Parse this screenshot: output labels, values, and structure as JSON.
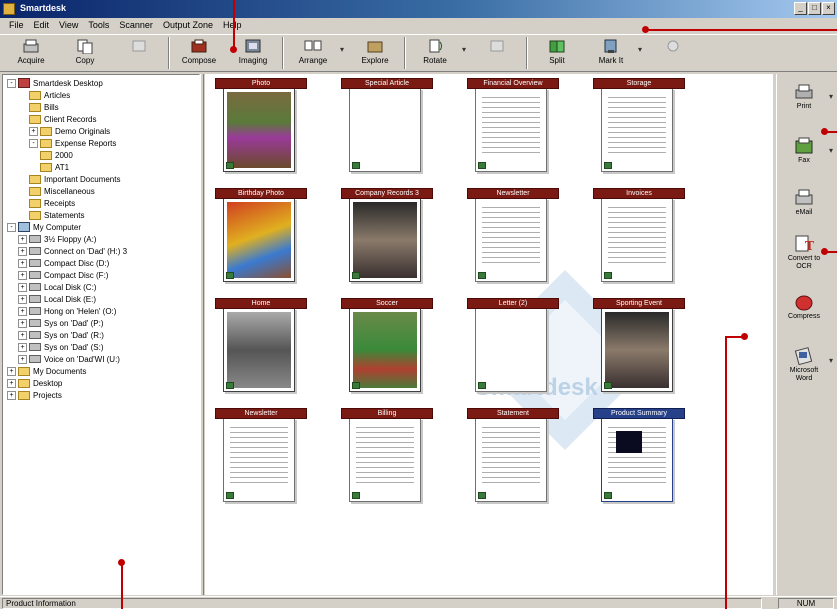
{
  "window": {
    "title": "Smartdesk"
  },
  "menubar": [
    "File",
    "Edit",
    "View",
    "Tools",
    "Scanner",
    "Output Zone",
    "Help"
  ],
  "toolbar": [
    {
      "label": "Acquire",
      "icon": "acquire-icon"
    },
    {
      "label": "Copy",
      "icon": "copy-icon"
    },
    {
      "label": "",
      "icon": "stack-icon",
      "disabled": true
    },
    {
      "label": "Compose",
      "icon": "compose-icon"
    },
    {
      "label": "Imaging",
      "icon": "imaging-icon"
    },
    {
      "label": "Arrange",
      "icon": "arrange-icon"
    },
    {
      "label": "Explore",
      "icon": "explore-icon"
    },
    {
      "label": "Rotate",
      "icon": "rotate-icon"
    },
    {
      "label": "",
      "icon": "layout-icon",
      "disabled": true
    },
    {
      "label": "Split",
      "icon": "split-icon"
    },
    {
      "label": "Mark It",
      "icon": "mark-icon"
    },
    {
      "label": "",
      "icon": "gear-icon",
      "disabled": true
    }
  ],
  "tree": [
    {
      "label": "Smartdesk Desktop",
      "indent": 0,
      "kind": "desk",
      "exp": "-"
    },
    {
      "label": "Articles",
      "indent": 2,
      "kind": "folder"
    },
    {
      "label": "Bills",
      "indent": 2,
      "kind": "folder"
    },
    {
      "label": "Client Records",
      "indent": 2,
      "kind": "folder"
    },
    {
      "label": "Demo Originals",
      "indent": 2,
      "kind": "folder",
      "exp": "+"
    },
    {
      "label": "Expense Reports",
      "indent": 2,
      "kind": "folder",
      "exp": "-"
    },
    {
      "label": "2000",
      "indent": 3,
      "kind": "folder"
    },
    {
      "label": "AT1",
      "indent": 3,
      "kind": "folder"
    },
    {
      "label": "Important Documents",
      "indent": 2,
      "kind": "folder"
    },
    {
      "label": "Miscellaneous",
      "indent": 2,
      "kind": "folder"
    },
    {
      "label": "Receipts",
      "indent": 2,
      "kind": "folder"
    },
    {
      "label": "Statements",
      "indent": 2,
      "kind": "folder"
    },
    {
      "label": "My Computer",
      "indent": 0,
      "kind": "computer",
      "exp": "-"
    },
    {
      "label": "3½ Floppy (A:)",
      "indent": 1,
      "kind": "drive",
      "exp": "+"
    },
    {
      "label": "Connect on 'Dad' (H:) 3",
      "indent": 1,
      "kind": "drive",
      "exp": "+"
    },
    {
      "label": "Compact Disc (D:)",
      "indent": 1,
      "kind": "drive",
      "exp": "+"
    },
    {
      "label": "Compact Disc (F:)",
      "indent": 1,
      "kind": "drive",
      "exp": "+"
    },
    {
      "label": "Local Disk (C:)",
      "indent": 1,
      "kind": "drive",
      "exp": "+"
    },
    {
      "label": "Local Disk (E:)",
      "indent": 1,
      "kind": "drive",
      "exp": "+"
    },
    {
      "label": "Hong on 'Helen' (O:)",
      "indent": 1,
      "kind": "drive",
      "exp": "+"
    },
    {
      "label": "Sys on 'Dad' (P:)",
      "indent": 1,
      "kind": "drive",
      "exp": "+"
    },
    {
      "label": "Sys on 'Dad' (R:)",
      "indent": 1,
      "kind": "drive",
      "exp": "+"
    },
    {
      "label": "Sys on 'Dad' (S:)",
      "indent": 1,
      "kind": "drive",
      "exp": "+"
    },
    {
      "label": "Voice on 'Dad'WI (U:)",
      "indent": 1,
      "kind": "drive",
      "exp": "+"
    },
    {
      "label": "My Documents",
      "indent": 0,
      "kind": "folder",
      "exp": "+"
    },
    {
      "label": "Desktop",
      "indent": 0,
      "kind": "folder",
      "exp": "+"
    },
    {
      "label": "Projects",
      "indent": 0,
      "kind": "folder",
      "exp": "+"
    }
  ],
  "piles": [
    {
      "label": "Photo",
      "type": "photo-kid",
      "col": 0,
      "row": 0
    },
    {
      "label": "Special Article",
      "type": "blank",
      "col": 1,
      "row": 0
    },
    {
      "label": "Financial Overview",
      "type": "text",
      "col": 2,
      "row": 0
    },
    {
      "label": "Storage",
      "type": "text",
      "col": 3,
      "row": 0
    },
    {
      "label": "Birthday Photo",
      "type": "photo-red",
      "col": 0,
      "row": 1
    },
    {
      "label": "Company Records 3",
      "type": "photo-dark",
      "col": 1,
      "row": 1
    },
    {
      "label": "Newsletter",
      "type": "text",
      "col": 2,
      "row": 1
    },
    {
      "label": "Invoices",
      "type": "text",
      "col": 3,
      "row": 1
    },
    {
      "label": "Home",
      "type": "photo-gray",
      "col": 0,
      "row": 2
    },
    {
      "label": "Soccer",
      "type": "photo-green",
      "col": 1,
      "row": 2
    },
    {
      "label": "Letter (2)",
      "type": "blank",
      "col": 2,
      "row": 2
    },
    {
      "label": "Sporting Event",
      "type": "photo-dark",
      "col": 3,
      "row": 2
    },
    {
      "label": "Newsletter",
      "type": "text",
      "col": 0,
      "row": 3
    },
    {
      "label": "Billing",
      "type": "text",
      "col": 1,
      "row": 3
    },
    {
      "label": "Statement",
      "type": "text",
      "col": 2,
      "row": 3
    },
    {
      "label": "Product Summary",
      "type": "blue-doc",
      "col": 3,
      "row": 3
    }
  ],
  "watermark": "Smartdesk",
  "sidebar": [
    {
      "label": "Print",
      "icon": "printer-icon",
      "drop": true
    },
    {
      "label": "Fax",
      "icon": "fax-icon",
      "drop": true
    },
    {
      "label": "eMail",
      "icon": "email-icon",
      "drop": false
    },
    {
      "label": "Convert to OCR",
      "icon": "ocr-icon",
      "drop": false
    },
    {
      "label": "Compress",
      "icon": "compress-icon",
      "drop": false
    },
    {
      "label": "Microsoft Word",
      "icon": "word-icon",
      "drop": true
    }
  ],
  "statusbar": {
    "left": "Product Information",
    "right": "NUM"
  },
  "colors": {
    "pile_label": "#7a1a12",
    "callout": "#c00000",
    "titlebar": "#0a246a"
  }
}
